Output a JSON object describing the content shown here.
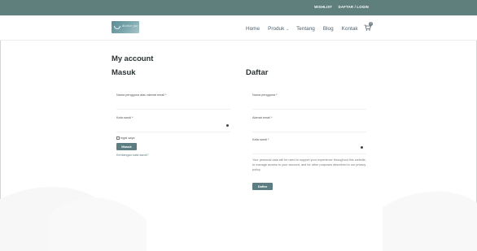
{
  "topbar": {
    "links": [
      "WISHLIST",
      "DAFTAR / LOGIN"
    ]
  },
  "header": {
    "logo_text": "doctor joe",
    "nav": [
      {
        "label": "Home"
      },
      {
        "label": "Produk",
        "has_dropdown": true
      },
      {
        "label": "Tentang"
      },
      {
        "label": "Blog"
      },
      {
        "label": "Kontak"
      }
    ],
    "cart_count": "0"
  },
  "page": {
    "title": "My account"
  },
  "login": {
    "title": "Masuk",
    "username_label": "Nama pengguna atau alamat email *",
    "password_label": "Kata sandi *",
    "remember_label": "Ingat saya",
    "submit_label": "Masuk",
    "lost_password": "Kehilangan kata sandi?"
  },
  "register": {
    "title": "Daftar",
    "username_label": "Nama pengguna *",
    "email_label": "Alamat email *",
    "password_label": "Kata sandi *",
    "privacy_text": "Your personal data will be used to support your experience throughout this website, to manage access to your account, and for other purposes described in our privacy policy.",
    "submit_label": "Daftar"
  },
  "colors": {
    "accent": "#5f7f7d",
    "button": "#5d7d82",
    "text": "#2d3436"
  }
}
